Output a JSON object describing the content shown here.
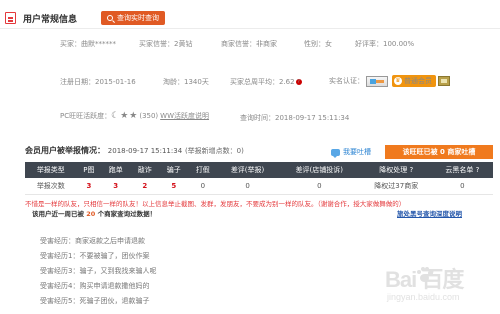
{
  "header": {
    "title": "用户常规信息",
    "query_button": "查询实时查询"
  },
  "info": {
    "seller_label": "买家：",
    "seller_value": "曲默******",
    "buyer_credit_label": "买家信誉：",
    "buyer_credit_value": "2黄钻",
    "merchant_credit_label": "商家信誉：",
    "merchant_credit_value": "非商家",
    "gender_label": "性别：",
    "gender_value": "女",
    "praise_label": "好评率：",
    "praise_value": "100.00%",
    "reg_label": "注册日期：",
    "reg_value": "2015-01-16",
    "taobao_label": "淘龄：",
    "taobao_value": "1340天",
    "buyer_weekly_label": "买家总周平均：",
    "buyer_weekly_value": "2.62",
    "realname_label": "实名认证：",
    "member_badge": "普通会员",
    "ww_label": "PC旺旺活跃度：",
    "ww_count": "(350)",
    "ww_link": "WW活跃度说明",
    "query_time_label": "查询时间：",
    "query_time_value": "2018-09-17 15:11:34"
  },
  "report": {
    "title": "会员用户被举报情况：",
    "timestamp": "2018-09-17 15:11:34",
    "note": "(举报新增点数：0)",
    "complain": "我要吐槽",
    "orange_button": "该旺旺已被 0 商家吐槽",
    "headers": [
      "举报类型",
      "P图",
      "跑单",
      "敲诈",
      "骗子",
      "打假",
      "差评(举报)",
      "差评(店铺投诉)",
      "降权处理 ?",
      "云黑名单 ?"
    ],
    "row": [
      "举报次数",
      "3",
      "3",
      "2",
      "5",
      "0",
      "0",
      "0",
      "降权过37商家",
      "0"
    ],
    "warning": "不惜是一样的队友，只相信一样的队友！以上信息举止截图、发群，发朋友，不要成为别一样的队友。（谢谢合作，授大家做舞做的）",
    "count_prefix": "该用户近一周已被",
    "count_num": "20",
    "count_suffix": "个商家查询过数据！",
    "deep_link": "旅处黑号查询深度说明"
  },
  "experiences": [
    "受害经历：商家返款之后申请退款",
    "受害经历1：不要被骗了，团伙作案",
    "受害经历3：骗子，又到我找来骗人呢",
    "受害经历4：购买申请退款撒他妈的",
    "受害经历5：死骗子团伙，退款骗子"
  ],
  "watermark": {
    "big": "Bai  百度",
    "small": "jingyan.baidu.com"
  },
  "colors": {
    "accent": "#e05a24",
    "orange": "#f07a1e",
    "header_dark": "#3f4650",
    "alert_red": "#d4111b",
    "link": "#2255aa"
  }
}
